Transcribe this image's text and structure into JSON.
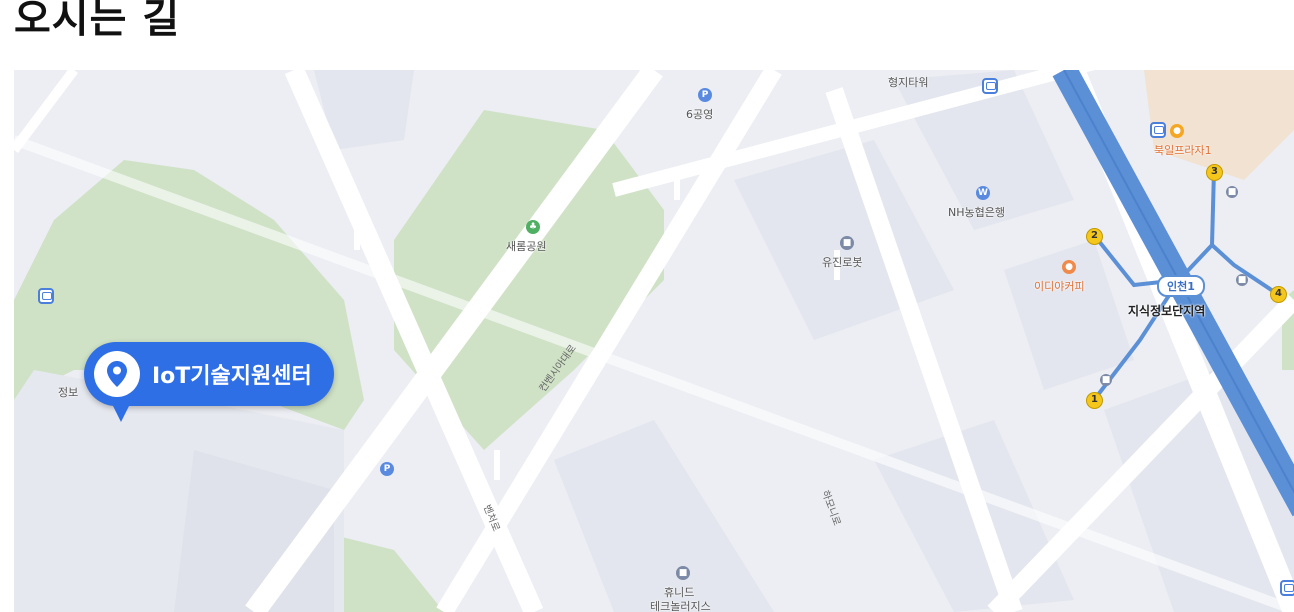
{
  "page": {
    "title": "오시는 길"
  },
  "map": {
    "marker": {
      "label": "IoT기술지원센터",
      "icon": "location-pin-icon"
    },
    "poi": {
      "parking_6": "6공영",
      "hyungji_tower": "형지타워",
      "saerom_park": "새롬공원",
      "yujin_robot": "유진로봇",
      "nh_bank": "NH농협은행",
      "ediya": "이디야커피",
      "bugil_plaza": "북일프라자1",
      "station": "지식정보단지역",
      "subway_line": "인천1",
      "hunid": "휴니드",
      "hunid2": "테크놀러지스",
      "left_partial": "정보"
    },
    "roads": {
      "diag_road": "컨벤시아대로",
      "beonjoro": "벤처로",
      "academy": "하모니로"
    },
    "exits": [
      "1",
      "2",
      "3",
      "4"
    ],
    "colors": {
      "marker": "#2f6fe5",
      "subway": "#5b8fd6",
      "park": "#cfe2c6",
      "exit": "#f5c61c"
    }
  }
}
